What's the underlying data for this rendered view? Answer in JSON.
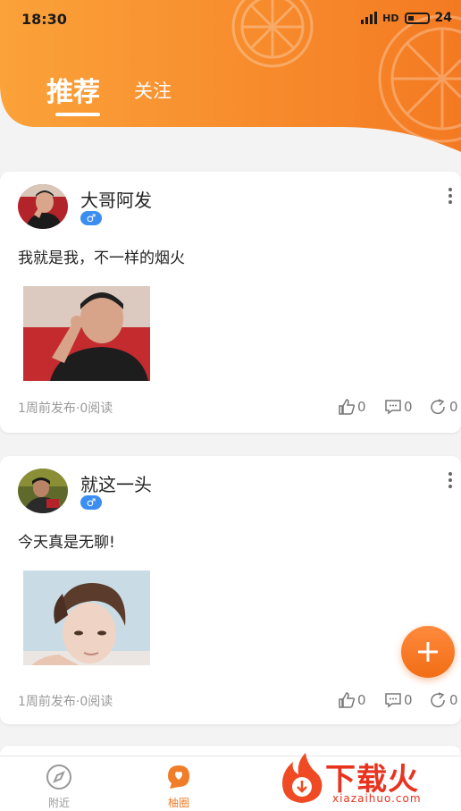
{
  "status_bar": {
    "time": "18:30",
    "network": "HD",
    "battery": "24"
  },
  "tabs": {
    "recommended": "推荐",
    "following": "关注"
  },
  "posts": [
    {
      "username": "大哥阿发",
      "gender": "♂",
      "text": "我就是我，不一样的烟火",
      "meta": "1周前发布·0阅读",
      "likes": "0",
      "comments": "0",
      "shares": "0"
    },
    {
      "username": "就这一头",
      "gender": "♂",
      "text": "今天真是无聊!",
      "meta": "1周前发布·0阅读",
      "likes": "0",
      "comments": "0",
      "shares": "0"
    }
  ],
  "bottom_nav": {
    "nearby": "附近",
    "circle": "柚圈"
  },
  "watermark": {
    "brand": "下载火",
    "domain": "xiazaihuo.com"
  },
  "colors": {
    "accent": "#f7811f",
    "accent_light": "#fbaa3b",
    "gender_badge": "#3b8ef0"
  }
}
